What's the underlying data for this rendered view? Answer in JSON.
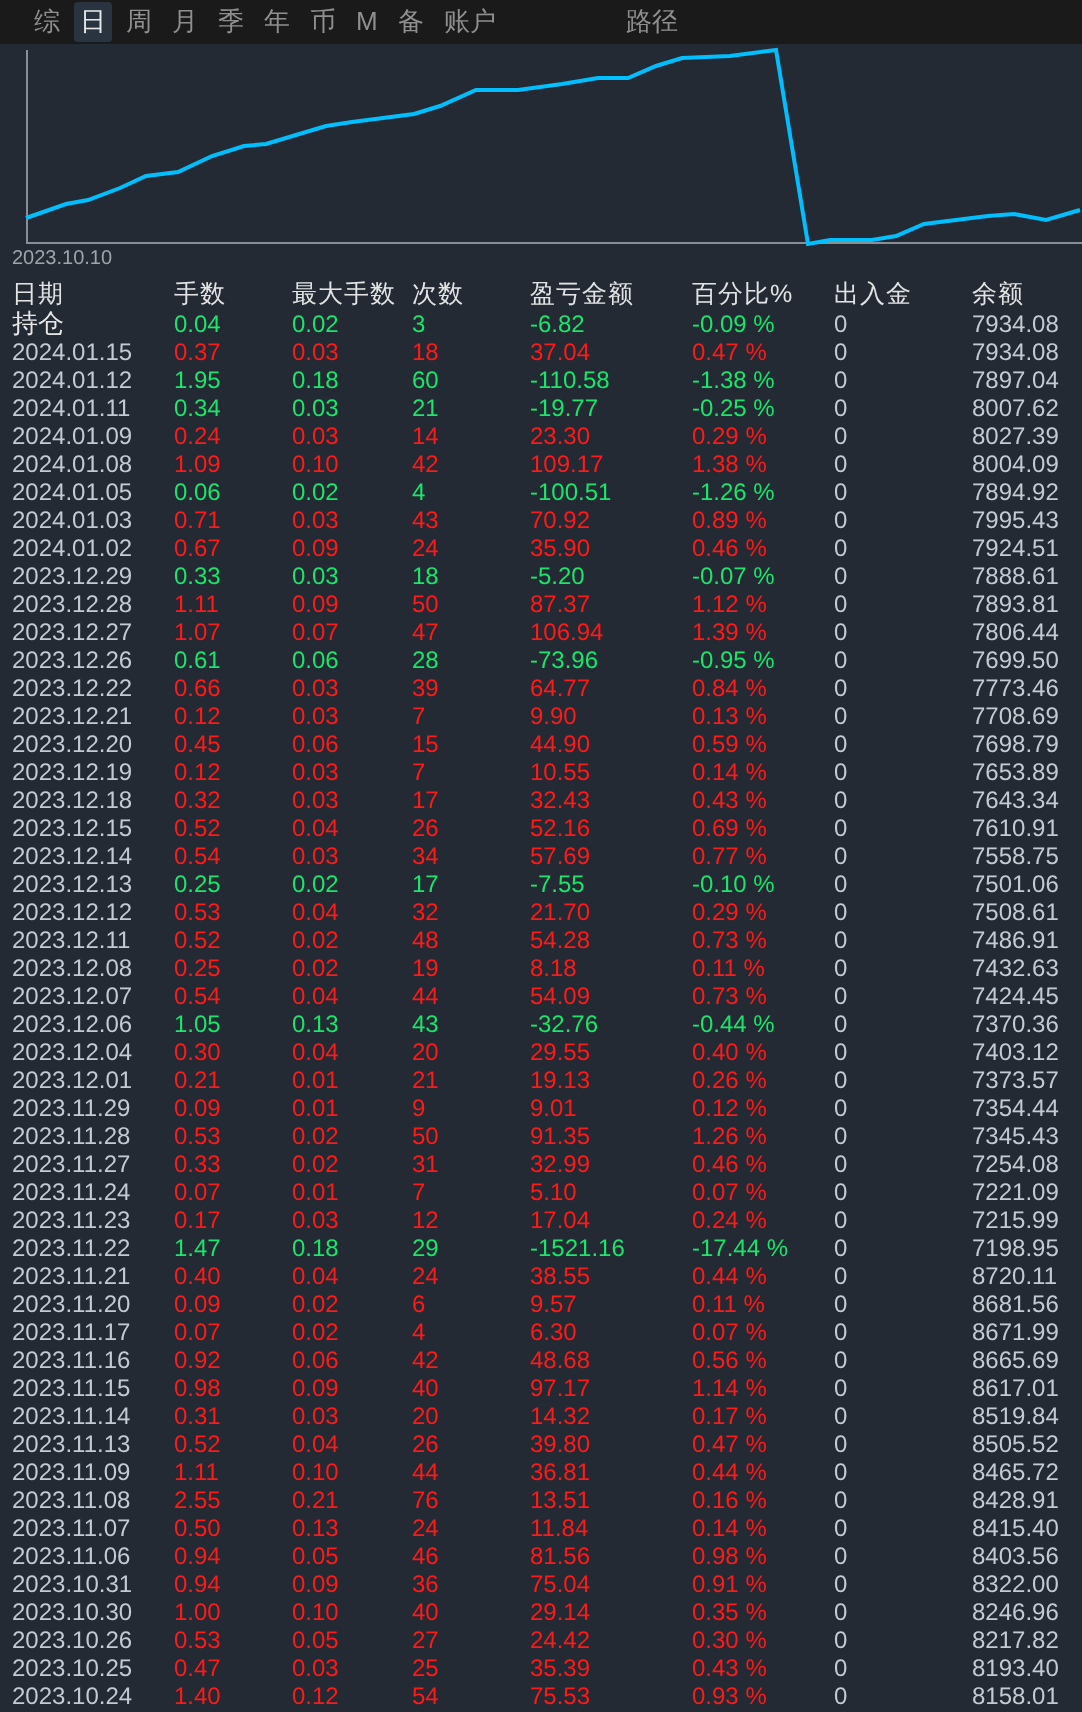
{
  "tabs": [
    {
      "label": "综",
      "selected": false
    },
    {
      "label": "日",
      "selected": true
    },
    {
      "label": "周",
      "selected": false
    },
    {
      "label": "月",
      "selected": false
    },
    {
      "label": "季",
      "selected": false
    },
    {
      "label": "年",
      "selected": false
    },
    {
      "label": "币",
      "selected": false
    },
    {
      "label": "M",
      "selected": false
    },
    {
      "label": "备",
      "selected": false
    },
    {
      "label": "账户",
      "selected": false
    }
  ],
  "path_label": "路径",
  "chart": {
    "start_label": "2023.10.10"
  },
  "table": {
    "columns": [
      "日期",
      "手数",
      "最大手数",
      "次数",
      "盈亏金额",
      "百分比%",
      "出入金",
      "余额"
    ],
    "rows": [
      {
        "date": "持仓",
        "lots": "0.04",
        "max_lots": "0.02",
        "count": "3",
        "pnl": "-6.82",
        "pct": "-0.09 %",
        "deposit": "0",
        "balance": "7934.08",
        "kind": "loss"
      },
      {
        "date": "2024.01.15",
        "lots": "0.37",
        "max_lots": "0.03",
        "count": "18",
        "pnl": "37.04",
        "pct": "0.47 %",
        "deposit": "0",
        "balance": "7934.08",
        "kind": "gain"
      },
      {
        "date": "2024.01.12",
        "lots": "1.95",
        "max_lots": "0.18",
        "count": "60",
        "pnl": "-110.58",
        "pct": "-1.38 %",
        "deposit": "0",
        "balance": "7897.04",
        "kind": "loss"
      },
      {
        "date": "2024.01.11",
        "lots": "0.34",
        "max_lots": "0.03",
        "count": "21",
        "pnl": "-19.77",
        "pct": "-0.25 %",
        "deposit": "0",
        "balance": "8007.62",
        "kind": "loss"
      },
      {
        "date": "2024.01.09",
        "lots": "0.24",
        "max_lots": "0.03",
        "count": "14",
        "pnl": "23.30",
        "pct": "0.29 %",
        "deposit": "0",
        "balance": "8027.39",
        "kind": "gain"
      },
      {
        "date": "2024.01.08",
        "lots": "1.09",
        "max_lots": "0.10",
        "count": "42",
        "pnl": "109.17",
        "pct": "1.38 %",
        "deposit": "0",
        "balance": "8004.09",
        "kind": "gain"
      },
      {
        "date": "2024.01.05",
        "lots": "0.06",
        "max_lots": "0.02",
        "count": "4",
        "pnl": "-100.51",
        "pct": "-1.26 %",
        "deposit": "0",
        "balance": "7894.92",
        "kind": "loss"
      },
      {
        "date": "2024.01.03",
        "lots": "0.71",
        "max_lots": "0.03",
        "count": "43",
        "pnl": "70.92",
        "pct": "0.89 %",
        "deposit": "0",
        "balance": "7995.43",
        "kind": "gain"
      },
      {
        "date": "2024.01.02",
        "lots": "0.67",
        "max_lots": "0.09",
        "count": "24",
        "pnl": "35.90",
        "pct": "0.46 %",
        "deposit": "0",
        "balance": "7924.51",
        "kind": "gain"
      },
      {
        "date": "2023.12.29",
        "lots": "0.33",
        "max_lots": "0.03",
        "count": "18",
        "pnl": "-5.20",
        "pct": "-0.07 %",
        "deposit": "0",
        "balance": "7888.61",
        "kind": "loss"
      },
      {
        "date": "2023.12.28",
        "lots": "1.11",
        "max_lots": "0.09",
        "count": "50",
        "pnl": "87.37",
        "pct": "1.12 %",
        "deposit": "0",
        "balance": "7893.81",
        "kind": "gain"
      },
      {
        "date": "2023.12.27",
        "lots": "1.07",
        "max_lots": "0.07",
        "count": "47",
        "pnl": "106.94",
        "pct": "1.39 %",
        "deposit": "0",
        "balance": "7806.44",
        "kind": "gain"
      },
      {
        "date": "2023.12.26",
        "lots": "0.61",
        "max_lots": "0.06",
        "count": "28",
        "pnl": "-73.96",
        "pct": "-0.95 %",
        "deposit": "0",
        "balance": "7699.50",
        "kind": "loss"
      },
      {
        "date": "2023.12.22",
        "lots": "0.66",
        "max_lots": "0.03",
        "count": "39",
        "pnl": "64.77",
        "pct": "0.84 %",
        "deposit": "0",
        "balance": "7773.46",
        "kind": "gain"
      },
      {
        "date": "2023.12.21",
        "lots": "0.12",
        "max_lots": "0.03",
        "count": "7",
        "pnl": "9.90",
        "pct": "0.13 %",
        "deposit": "0",
        "balance": "7708.69",
        "kind": "gain"
      },
      {
        "date": "2023.12.20",
        "lots": "0.45",
        "max_lots": "0.06",
        "count": "15",
        "pnl": "44.90",
        "pct": "0.59 %",
        "deposit": "0",
        "balance": "7698.79",
        "kind": "gain"
      },
      {
        "date": "2023.12.19",
        "lots": "0.12",
        "max_lots": "0.03",
        "count": "7",
        "pnl": "10.55",
        "pct": "0.14 %",
        "deposit": "0",
        "balance": "7653.89",
        "kind": "gain"
      },
      {
        "date": "2023.12.18",
        "lots": "0.32",
        "max_lots": "0.03",
        "count": "17",
        "pnl": "32.43",
        "pct": "0.43 %",
        "deposit": "0",
        "balance": "7643.34",
        "kind": "gain"
      },
      {
        "date": "2023.12.15",
        "lots": "0.52",
        "max_lots": "0.04",
        "count": "26",
        "pnl": "52.16",
        "pct": "0.69 %",
        "deposit": "0",
        "balance": "7610.91",
        "kind": "gain"
      },
      {
        "date": "2023.12.14",
        "lots": "0.54",
        "max_lots": "0.03",
        "count": "34",
        "pnl": "57.69",
        "pct": "0.77 %",
        "deposit": "0",
        "balance": "7558.75",
        "kind": "gain"
      },
      {
        "date": "2023.12.13",
        "lots": "0.25",
        "max_lots": "0.02",
        "count": "17",
        "pnl": "-7.55",
        "pct": "-0.10 %",
        "deposit": "0",
        "balance": "7501.06",
        "kind": "loss"
      },
      {
        "date": "2023.12.12",
        "lots": "0.53",
        "max_lots": "0.04",
        "count": "32",
        "pnl": "21.70",
        "pct": "0.29 %",
        "deposit": "0",
        "balance": "7508.61",
        "kind": "gain"
      },
      {
        "date": "2023.12.11",
        "lots": "0.52",
        "max_lots": "0.02",
        "count": "48",
        "pnl": "54.28",
        "pct": "0.73 %",
        "deposit": "0",
        "balance": "7486.91",
        "kind": "gain"
      },
      {
        "date": "2023.12.08",
        "lots": "0.25",
        "max_lots": "0.02",
        "count": "19",
        "pnl": "8.18",
        "pct": "0.11 %",
        "deposit": "0",
        "balance": "7432.63",
        "kind": "gain"
      },
      {
        "date": "2023.12.07",
        "lots": "0.54",
        "max_lots": "0.04",
        "count": "44",
        "pnl": "54.09",
        "pct": "0.73 %",
        "deposit": "0",
        "balance": "7424.45",
        "kind": "gain"
      },
      {
        "date": "2023.12.06",
        "lots": "1.05",
        "max_lots": "0.13",
        "count": "43",
        "pnl": "-32.76",
        "pct": "-0.44 %",
        "deposit": "0",
        "balance": "7370.36",
        "kind": "loss"
      },
      {
        "date": "2023.12.04",
        "lots": "0.30",
        "max_lots": "0.04",
        "count": "20",
        "pnl": "29.55",
        "pct": "0.40 %",
        "deposit": "0",
        "balance": "7403.12",
        "kind": "gain"
      },
      {
        "date": "2023.12.01",
        "lots": "0.21",
        "max_lots": "0.01",
        "count": "21",
        "pnl": "19.13",
        "pct": "0.26 %",
        "deposit": "0",
        "balance": "7373.57",
        "kind": "gain"
      },
      {
        "date": "2023.11.29",
        "lots": "0.09",
        "max_lots": "0.01",
        "count": "9",
        "pnl": "9.01",
        "pct": "0.12 %",
        "deposit": "0",
        "balance": "7354.44",
        "kind": "gain"
      },
      {
        "date": "2023.11.28",
        "lots": "0.53",
        "max_lots": "0.02",
        "count": "50",
        "pnl": "91.35",
        "pct": "1.26 %",
        "deposit": "0",
        "balance": "7345.43",
        "kind": "gain"
      },
      {
        "date": "2023.11.27",
        "lots": "0.33",
        "max_lots": "0.02",
        "count": "31",
        "pnl": "32.99",
        "pct": "0.46 %",
        "deposit": "0",
        "balance": "7254.08",
        "kind": "gain"
      },
      {
        "date": "2023.11.24",
        "lots": "0.07",
        "max_lots": "0.01",
        "count": "7",
        "pnl": "5.10",
        "pct": "0.07 %",
        "deposit": "0",
        "balance": "7221.09",
        "kind": "gain"
      },
      {
        "date": "2023.11.23",
        "lots": "0.17",
        "max_lots": "0.03",
        "count": "12",
        "pnl": "17.04",
        "pct": "0.24 %",
        "deposit": "0",
        "balance": "7215.99",
        "kind": "gain"
      },
      {
        "date": "2023.11.22",
        "lots": "1.47",
        "max_lots": "0.18",
        "count": "29",
        "pnl": "-1521.16",
        "pct": "-17.44 %",
        "deposit": "0",
        "balance": "7198.95",
        "kind": "loss"
      },
      {
        "date": "2023.11.21",
        "lots": "0.40",
        "max_lots": "0.04",
        "count": "24",
        "pnl": "38.55",
        "pct": "0.44 %",
        "deposit": "0",
        "balance": "8720.11",
        "kind": "gain"
      },
      {
        "date": "2023.11.20",
        "lots": "0.09",
        "max_lots": "0.02",
        "count": "6",
        "pnl": "9.57",
        "pct": "0.11 %",
        "deposit": "0",
        "balance": "8681.56",
        "kind": "gain"
      },
      {
        "date": "2023.11.17",
        "lots": "0.07",
        "max_lots": "0.02",
        "count": "4",
        "pnl": "6.30",
        "pct": "0.07 %",
        "deposit": "0",
        "balance": "8671.99",
        "kind": "gain"
      },
      {
        "date": "2023.11.16",
        "lots": "0.92",
        "max_lots": "0.06",
        "count": "42",
        "pnl": "48.68",
        "pct": "0.56 %",
        "deposit": "0",
        "balance": "8665.69",
        "kind": "gain"
      },
      {
        "date": "2023.11.15",
        "lots": "0.98",
        "max_lots": "0.09",
        "count": "40",
        "pnl": "97.17",
        "pct": "1.14 %",
        "deposit": "0",
        "balance": "8617.01",
        "kind": "gain"
      },
      {
        "date": "2023.11.14",
        "lots": "0.31",
        "max_lots": "0.03",
        "count": "20",
        "pnl": "14.32",
        "pct": "0.17 %",
        "deposit": "0",
        "balance": "8519.84",
        "kind": "gain"
      },
      {
        "date": "2023.11.13",
        "lots": "0.52",
        "max_lots": "0.04",
        "count": "26",
        "pnl": "39.80",
        "pct": "0.47 %",
        "deposit": "0",
        "balance": "8505.52",
        "kind": "gain"
      },
      {
        "date": "2023.11.09",
        "lots": "1.11",
        "max_lots": "0.10",
        "count": "44",
        "pnl": "36.81",
        "pct": "0.44 %",
        "deposit": "0",
        "balance": "8465.72",
        "kind": "gain"
      },
      {
        "date": "2023.11.08",
        "lots": "2.55",
        "max_lots": "0.21",
        "count": "76",
        "pnl": "13.51",
        "pct": "0.16 %",
        "deposit": "0",
        "balance": "8428.91",
        "kind": "gain"
      },
      {
        "date": "2023.11.07",
        "lots": "0.50",
        "max_lots": "0.13",
        "count": "24",
        "pnl": "11.84",
        "pct": "0.14 %",
        "deposit": "0",
        "balance": "8415.40",
        "kind": "gain"
      },
      {
        "date": "2023.11.06",
        "lots": "0.94",
        "max_lots": "0.05",
        "count": "46",
        "pnl": "81.56",
        "pct": "0.98 %",
        "deposit": "0",
        "balance": "8403.56",
        "kind": "gain"
      },
      {
        "date": "2023.10.31",
        "lots": "0.94",
        "max_lots": "0.09",
        "count": "36",
        "pnl": "75.04",
        "pct": "0.91 %",
        "deposit": "0",
        "balance": "8322.00",
        "kind": "gain"
      },
      {
        "date": "2023.10.30",
        "lots": "1.00",
        "max_lots": "0.10",
        "count": "40",
        "pnl": "29.14",
        "pct": "0.35 %",
        "deposit": "0",
        "balance": "8246.96",
        "kind": "gain"
      },
      {
        "date": "2023.10.26",
        "lots": "0.53",
        "max_lots": "0.05",
        "count": "27",
        "pnl": "24.42",
        "pct": "0.30 %",
        "deposit": "0",
        "balance": "8217.82",
        "kind": "gain"
      },
      {
        "date": "2023.10.25",
        "lots": "0.47",
        "max_lots": "0.03",
        "count": "25",
        "pnl": "35.39",
        "pct": "0.43 %",
        "deposit": "0",
        "balance": "8193.40",
        "kind": "gain"
      },
      {
        "date": "2023.10.24",
        "lots": "1.40",
        "max_lots": "0.12",
        "count": "54",
        "pnl": "75.53",
        "pct": "0.93 %",
        "deposit": "0",
        "balance": "8158.01",
        "kind": "gain"
      }
    ]
  }
}
